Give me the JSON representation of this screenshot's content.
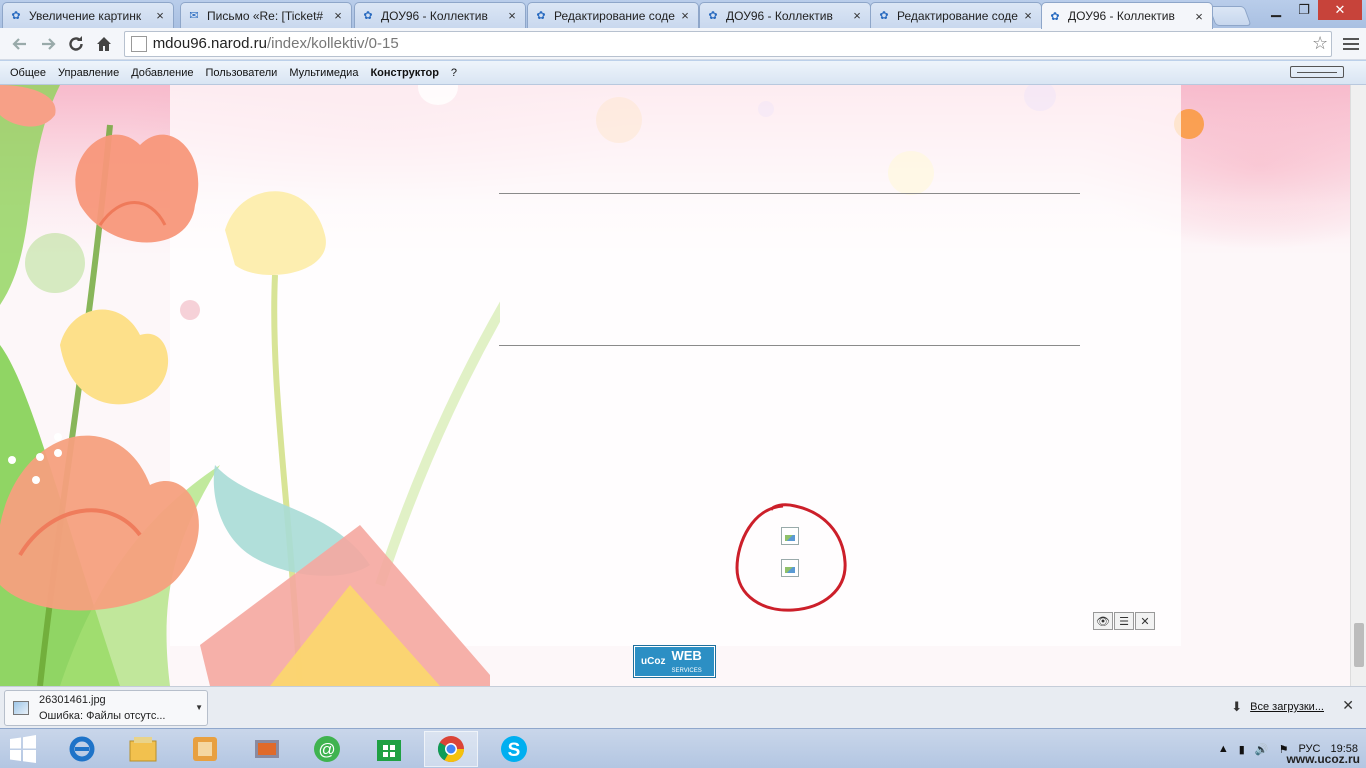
{
  "tabs": [
    {
      "title": "Увеличение картинк",
      "icon": "people-icon"
    },
    {
      "title": "Письмо «Re: [Ticket#",
      "icon": "mail-icon"
    },
    {
      "title": "ДОУ96 - Коллектив",
      "icon": "people-icon"
    },
    {
      "title": "Редактирование соде",
      "icon": "people-icon"
    },
    {
      "title": "ДОУ96 - Коллектив",
      "icon": "people-icon"
    },
    {
      "title": "Редактирование соде",
      "icon": "people-icon"
    },
    {
      "title": "ДОУ96 - Коллектив",
      "icon": "people-icon",
      "active": true
    }
  ],
  "omnibox": {
    "host": "mdou96.narod.ru",
    "path": "/index/kollektiv/0-15"
  },
  "adminbar": {
    "items": [
      "Общее",
      "Управление",
      "Добавление",
      "Пользователи",
      "Мультимедиа",
      "Конструктор",
      "?"
    ],
    "active_index": 5
  },
  "banner": {
    "logo": "uCoz",
    "web": "WEB",
    "services": "SERVICES"
  },
  "download": {
    "filename": "26301461.jpg",
    "status": "Ошибка: Файлы отсутс..."
  },
  "all_downloads": "Все загрузки...",
  "tray": {
    "lang": "РУС",
    "time": "19:58"
  },
  "watermark": "www.ucoz.ru",
  "colors": {
    "accent": "#2b6cc0",
    "annotation_circle": "#cc1f2a",
    "close_button": "#c7433a"
  }
}
